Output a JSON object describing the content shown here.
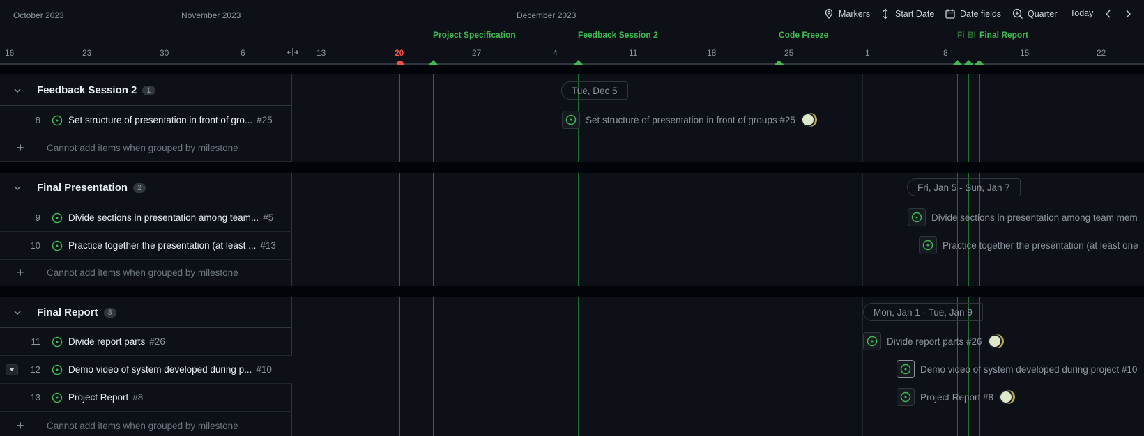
{
  "toolbar": {
    "markers": "Markers",
    "start_date": "Start Date",
    "date_fields": "Date fields",
    "quarter": "Quarter",
    "today": "Today"
  },
  "months": [
    "October 2023",
    "November 2023",
    "December 2023"
  ],
  "days": [
    "16",
    "23",
    "30",
    "6",
    "13",
    "20",
    "27",
    "4",
    "11",
    "18",
    "25",
    "1",
    "8",
    "15",
    "22"
  ],
  "milestones": {
    "project_spec": "Project Specification",
    "feedback2": "Feedback Session 2",
    "code_freeze": "Code Freeze",
    "fi": "Fi",
    "bl": "Bl",
    "final_report": "Final Report"
  },
  "groups": [
    {
      "title": "Feedback Session 2",
      "count": "1",
      "date_range": "Tue, Dec 5",
      "items": [
        {
          "num": "8",
          "title": "Set structure of presentation in front of gro...",
          "id": "#25",
          "bar": "Set structure of presentation in front of groups #25"
        }
      ],
      "add_text": "Cannot add items when grouped by milestone"
    },
    {
      "title": "Final Presentation",
      "count": "2",
      "date_range": "Fri, Jan 5 - Sun, Jan 7",
      "items": [
        {
          "num": "9",
          "title": "Divide sections in presentation among team...",
          "id": "#5",
          "bar": "Divide sections in presentation among team mem"
        },
        {
          "num": "10",
          "title": "Practice together the presentation (at least ...",
          "id": "#13",
          "bar": "Practice together the presentation (at least one"
        }
      ],
      "add_text": "Cannot add items when grouped by milestone"
    },
    {
      "title": "Final Report",
      "count": "3",
      "date_range": "Mon, Jan 1 - Tue, Jan 9",
      "items": [
        {
          "num": "11",
          "title": "Divide report parts",
          "id": "#26",
          "bar": "Divide report parts #26"
        },
        {
          "num": "12",
          "title": "Demo video of system developed during p...",
          "id": "#10",
          "bar": "Demo video of system developed during project #10"
        },
        {
          "num": "13",
          "title": "Project Report",
          "id": "#8",
          "bar": "Project Report #8"
        }
      ],
      "add_text": "Cannot add items when grouped by milestone"
    }
  ]
}
